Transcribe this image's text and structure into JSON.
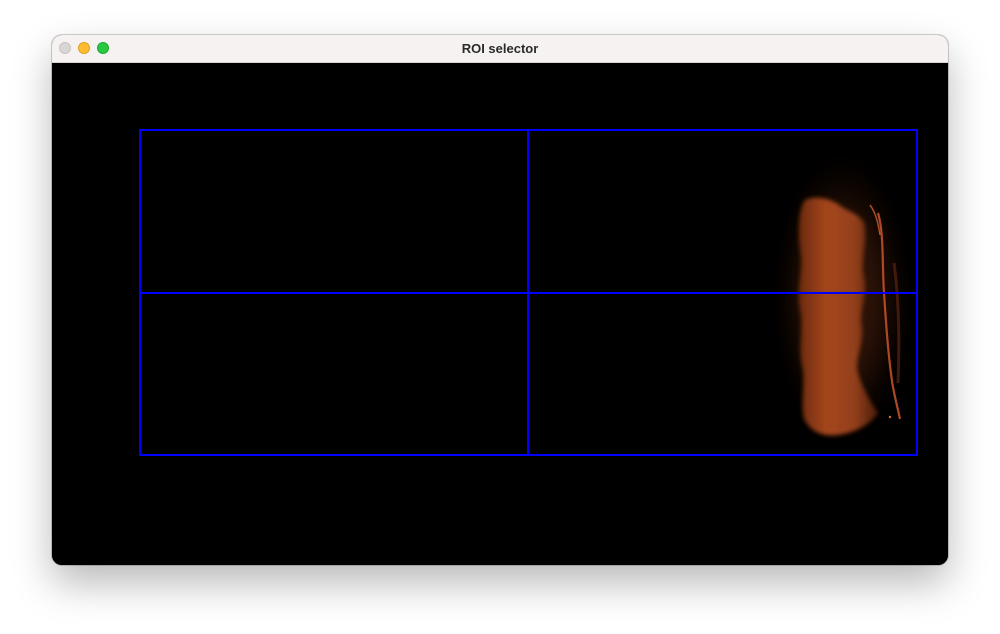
{
  "window": {
    "title": "ROI selector",
    "buttons": {
      "close": "close",
      "minimize": "minimize",
      "zoom": "zoom"
    }
  },
  "roi_grid": {
    "rows": 2,
    "columns": 2,
    "line_color": "#0000ff"
  },
  "colors": {
    "background": "#000000",
    "glow": "#b4501e"
  }
}
